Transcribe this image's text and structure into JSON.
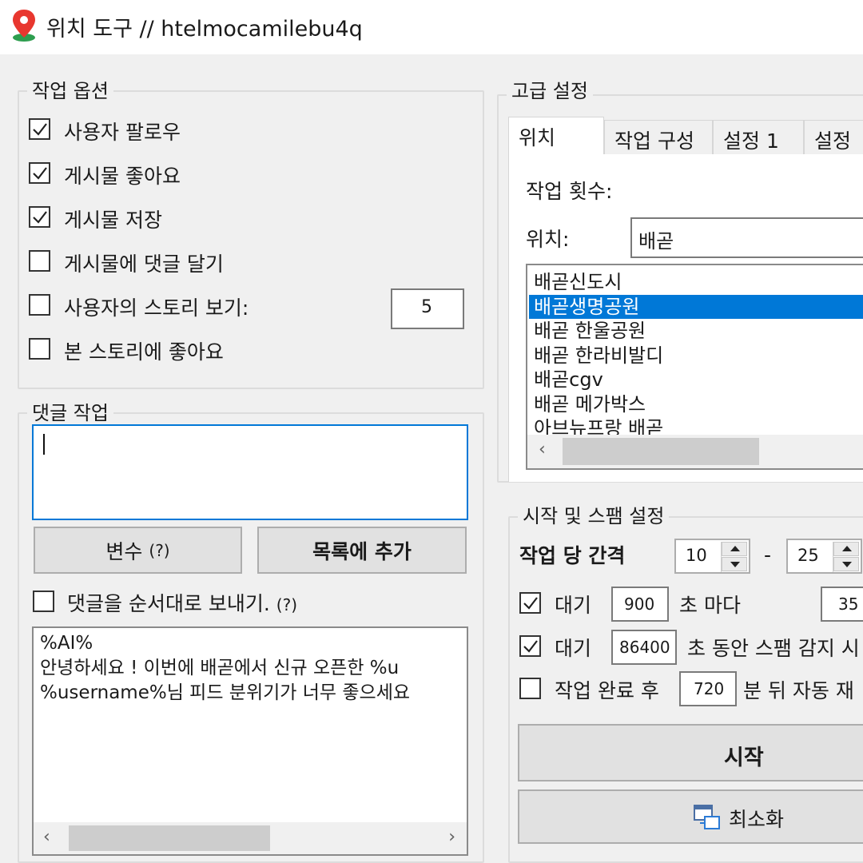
{
  "window": {
    "title": "위치 도구 // htelmocamilebu4q",
    "icon": "map-pin-icon",
    "pin_color": "#e8372f"
  },
  "task_options": {
    "legend": "작업 옵션",
    "items": [
      {
        "label": "사용자 팔로우",
        "checked": true
      },
      {
        "label": "게시물 좋아요",
        "checked": true
      },
      {
        "label": "게시물 저장",
        "checked": true
      },
      {
        "label": "게시물에 댓글 달기",
        "checked": false
      },
      {
        "label": "사용자의 스토리 보기:",
        "checked": false
      },
      {
        "label": "본 스토리에 좋아요",
        "checked": false
      }
    ],
    "story_count": "5"
  },
  "comment_task": {
    "legend": "댓글 작업",
    "input_value": "",
    "variables_button": "변수",
    "variables_help": "(?)",
    "add_to_list_button": "목록에 추가",
    "send_in_order_label": "댓글을 순서대로 보내기.",
    "send_in_order_help": "(?)",
    "send_in_order_checked": false,
    "comments": [
      "%AI%",
      "안녕하세요 ! 이번에 배곧에서 신규 오픈한 %u",
      "%username%님 피드 분위기가 너무 좋으세요"
    ]
  },
  "advanced": {
    "legend": "고급 설정",
    "tabs": [
      "위치",
      "작업 구성",
      "설정 1",
      "설정"
    ],
    "active_tab": "위치",
    "task_count_label": "작업 횟수:",
    "location_label": "위치:",
    "location_value": "배곧",
    "location_results": [
      "배곧신도시",
      "배곧생명공원",
      "배곧 한울공원",
      "배곧 한라비발디",
      "배곧cgv",
      "배곧 메가박스",
      "아브뉴프랑 배곧"
    ],
    "selected_result": "배곧생명공원",
    "selection_color": "#0078d7"
  },
  "start_spam": {
    "legend": "시작 및 스팸 설정",
    "interval_label": "작업 당 간격",
    "interval_min": "10",
    "interval_sep": "-",
    "interval_max": "25",
    "wait1": {
      "checked": true,
      "label": "대기",
      "value": "900",
      "suffix": "초 마다",
      "value2": "35"
    },
    "wait2": {
      "checked": true,
      "label": "대기",
      "value": "86400",
      "suffix": "초 동안 스팸 감지 시"
    },
    "restart": {
      "checked": false,
      "label": "작업 완료 후",
      "value": "720",
      "suffix": "분 뒤 자동 재"
    },
    "start_button": "시작",
    "minimize_button": "최소화"
  }
}
